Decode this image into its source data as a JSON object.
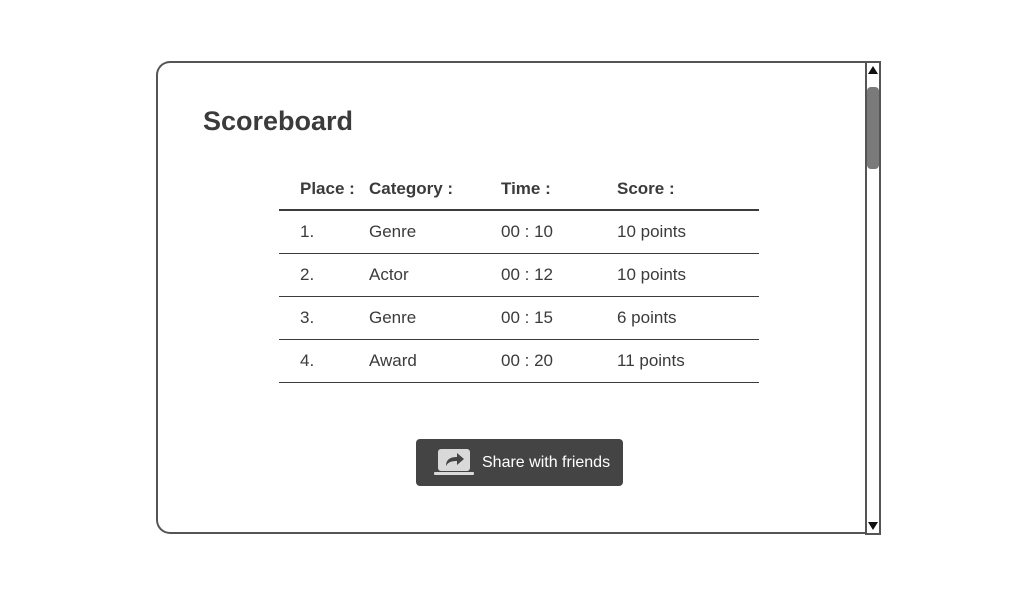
{
  "title": "Scoreboard",
  "table": {
    "headers": {
      "place": "Place :",
      "category": "Category :",
      "time": "Time :",
      "score": "Score :"
    },
    "rows": [
      {
        "place": "1.",
        "category": "Genre",
        "time": "00 : 10",
        "score": "10 points"
      },
      {
        "place": "2.",
        "category": "Actor",
        "time": "00 : 12",
        "score": "10 points"
      },
      {
        "place": "3.",
        "category": "Genre",
        "time": "00 : 15",
        "score": "6 points"
      },
      {
        "place": "4.",
        "category": "Award",
        "time": "00 : 20",
        "score": "11 points"
      }
    ]
  },
  "share_button": {
    "label": "Share with friends",
    "icon": "share-icon"
  },
  "scrollbar": {
    "up_icon": "scroll-up-arrow-icon",
    "down_icon": "scroll-down-arrow-icon"
  }
}
